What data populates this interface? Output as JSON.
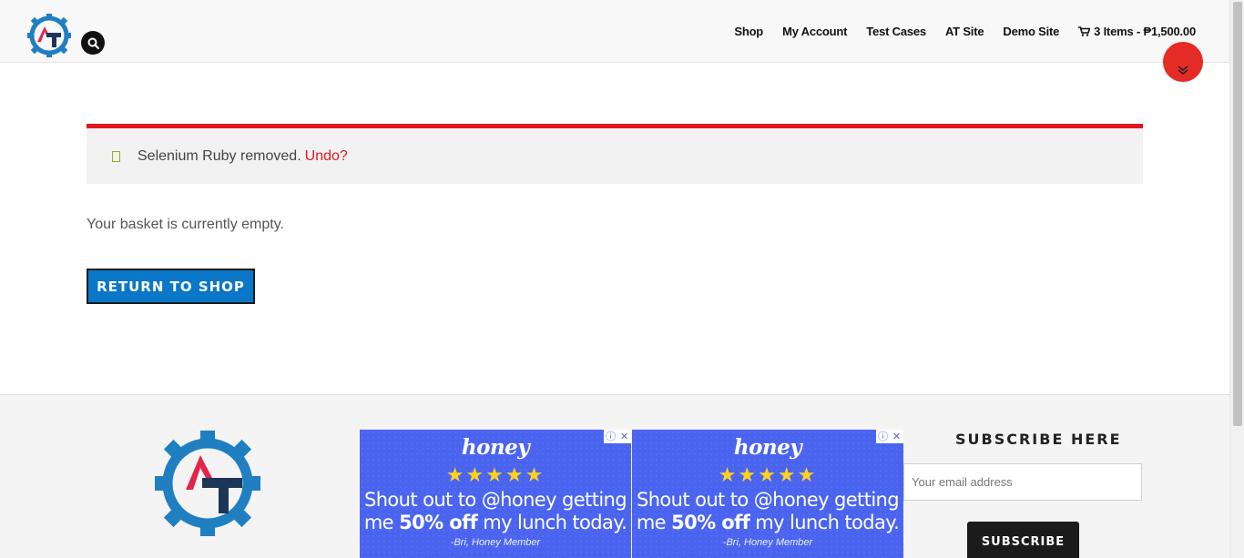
{
  "header": {
    "nav": [
      {
        "label": "Shop"
      },
      {
        "label": "My Account"
      },
      {
        "label": "Test Cases"
      },
      {
        "label": "AT Site"
      },
      {
        "label": "Demo Site"
      }
    ],
    "cart_label": "3 Items - ₱1,500.00"
  },
  "notice": {
    "message": "Selenium Ruby removed.",
    "undo_label": "Undo?"
  },
  "cart": {
    "empty_message": "Your basket is currently empty.",
    "return_button": "RETURN TO SHOP"
  },
  "ads": [
    {
      "brand": "honey",
      "stars": "★★★★★",
      "quote_pre": "Shout out to @honey getting me ",
      "quote_bold": "50% off",
      "quote_post": " my lunch today.",
      "attribution": "-Bri, Honey Member"
    },
    {
      "brand": "honey",
      "stars": "★★★★★",
      "quote_pre": "Shout out to @honey getting me ",
      "quote_bold": "50% off",
      "quote_post": " my lunch today.",
      "attribution": "-Bri, Honey Member"
    }
  ],
  "subscribe": {
    "title": "SUBSCRIBE HERE",
    "placeholder": "Your email address",
    "button": "SUBSCRIBE"
  },
  "colors": {
    "accent_red": "#e2171e",
    "button_blue": "#0a77c8",
    "ad_blue": "#4a64f0"
  }
}
